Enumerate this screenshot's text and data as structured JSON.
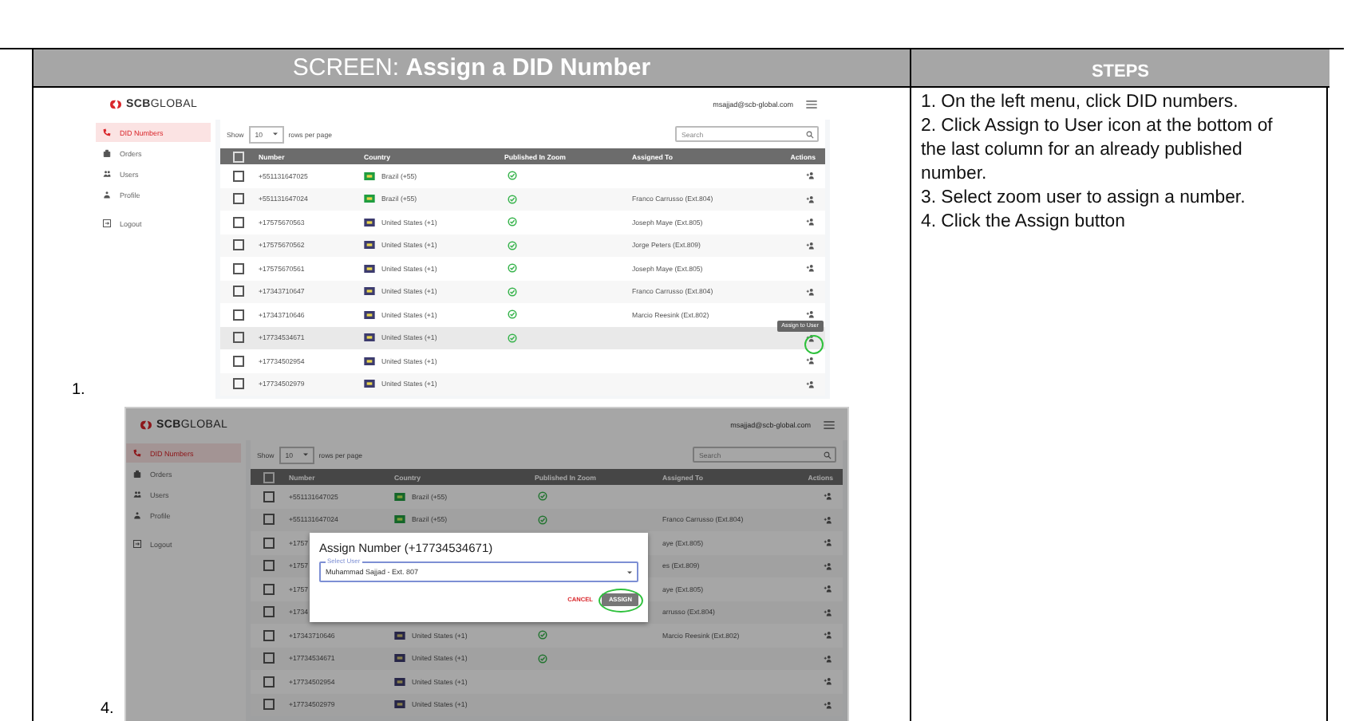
{
  "document": {
    "screen_title": "SCREEN: **Assign a DID Number**",
    "steps_title": "STEPS",
    "steps": [
      "1. On the left menu, click DID numbers.",
      "2. Click Assign to User icon at the bottom of the last column for an already published number.",
      "3. Select zoom user to assign a number.",
      "4. Click the Assign button"
    ],
    "screenshots": [
      {
        "label": "1.",
        "dimmed": false,
        "app": {
          "logo": "**SCB**GLOBAL",
          "email": "msajjad@scb-global.com",
          "show_label": "Show",
          "page_size": "10",
          "rows_per_page": "rows per page",
          "search": {
            "placeholder": "Search"
          },
          "sidebar": [
            {
              "label": "DID Numbers",
              "selected": true
            },
            {
              "label": "Orders",
              "selected": false
            },
            {
              "label": "Users",
              "selected": false
            },
            {
              "label": "Profile",
              "selected": false
            },
            {
              "label": "Logout",
              "selected": false
            }
          ],
          "select_all_checked": false,
          "columns": [
            "Number",
            "Country",
            "Published In Zoom",
            "Assigned To",
            "Actions"
          ],
          "rows": [
            {
              "number": "+551131647025",
              "country": "Brazil (+55)",
              "color": "#1f9d3f",
              "published": true,
              "highlighted": false,
              "circled": false
            },
            {
              "number": "+551131647024",
              "country": "Brazil (+55)",
              "color": "#1f9d3f",
              "published": true,
              "assigned": "Franco Carrusso (Ext.804)",
              "highlighted": false,
              "circled": false
            },
            {
              "number": "+17575670563",
              "country": "United States (+1)",
              "color": "#3c3b6e",
              "published": true,
              "assigned": "Joseph Maye (Ext.805)",
              "highlighted": false,
              "circled": false
            },
            {
              "number": "+17575670562",
              "country": "United States (+1)",
              "color": "#3c3b6e",
              "published": true,
              "assigned": "Jorge Peters (Ext.809)",
              "highlighted": false,
              "circled": false
            },
            {
              "number": "+17575670561",
              "country": "United States (+1)",
              "color": "#3c3b6e",
              "published": true,
              "assigned": "Joseph Maye (Ext.805)",
              "highlighted": false,
              "circled": false
            },
            {
              "number": "+17343710647",
              "country": "United States (+1)",
              "color": "#3c3b6e",
              "published": true,
              "assigned": "Franco Carrusso (Ext.804)",
              "highlighted": false,
              "circled": false
            },
            {
              "number": "+17343710646",
              "country": "United States (+1)",
              "color": "#3c3b6e",
              "published": true,
              "assigned": "Marcio Reesink (Ext.802)",
              "highlighted": false,
              "circled": false
            },
            {
              "number": "+17734534671",
              "country": "United States (+1)",
              "color": "#3c3b6e",
              "published": true,
              "highlighted": true,
              "circled": true,
              "tooltip": "Assign to User"
            },
            {
              "number": "+17734502954",
              "country": "United States (+1)",
              "color": "#3c3b6e",
              "published": false,
              "highlighted": false,
              "circled": false
            },
            {
              "number": "+17734502979",
              "country": "United States (+1)",
              "color": "#3c3b6e",
              "published": false,
              "highlighted": false,
              "circled": false
            }
          ]
        }
      },
      {
        "label": "4.",
        "dimmed": true,
        "app": {
          "logo": "**SCB**GLOBAL",
          "email": "msajjad@scb-global.com",
          "show_label": "Show",
          "page_size": "10",
          "rows_per_page": "rows per page",
          "search": {
            "placeholder": "Search"
          },
          "sidebar": [
            {
              "label": "DID Numbers",
              "selected": true
            },
            {
              "label": "Orders",
              "selected": false
            },
            {
              "label": "Users",
              "selected": false
            },
            {
              "label": "Profile",
              "selected": false
            },
            {
              "label": "Logout",
              "selected": false
            }
          ],
          "select_all_checked": false,
          "columns": [
            "Number",
            "Country",
            "Published In Zoom",
            "Assigned To",
            "Actions"
          ],
          "rows": [
            {
              "number": "+551131647025",
              "country": "Brazil (+55)",
              "color": "#146629",
              "published": true,
              "highlighted": false,
              "circled": false
            },
            {
              "number": "+551131647024",
              "country": "Brazil (+55)",
              "color": "#146629",
              "published": true,
              "assigned": "Franco Carrusso (Ext.804)",
              "highlighted": false,
              "circled": false
            },
            {
              "number": "+1757",
              "assigned": "aye (Ext.805)",
              "highlighted": false,
              "circled": false
            },
            {
              "number": "+1757",
              "assigned": "es (Ext.809)",
              "highlighted": false,
              "circled": false
            },
            {
              "number": "+1757",
              "assigned": "aye (Ext.805)",
              "highlighted": false,
              "circled": false
            },
            {
              "number": "+1734",
              "assigned": "arrusso (Ext.804)",
              "highlighted": false,
              "circled": false
            },
            {
              "number": "+17343710646",
              "country": "United States (+1)",
              "color": "#272648",
              "published": true,
              "assigned": "Marcio Reesink (Ext.802)",
              "highlighted": false,
              "circled": false
            },
            {
              "number": "+17734534671",
              "country": "United States (+1)",
              "color": "#272648",
              "published": true,
              "highlighted": false,
              "circled": false
            },
            {
              "number": "+17734502954",
              "country": "United States (+1)",
              "color": "#272648",
              "published": false,
              "highlighted": false,
              "circled": false
            },
            {
              "number": "+17734502979",
              "country": "United States (+1)",
              "color": "#272648",
              "published": false,
              "highlighted": false,
              "circled": false
            }
          ],
          "dialog": {
            "title": "Assign Number (+17734534671)",
            "select_label": "Select User",
            "select_value": "Muhammad Sajjad - Ext. 807",
            "cancel": "CANCEL",
            "assign": "ASSIGN",
            "assign_circled": true
          }
        }
      }
    ]
  }
}
